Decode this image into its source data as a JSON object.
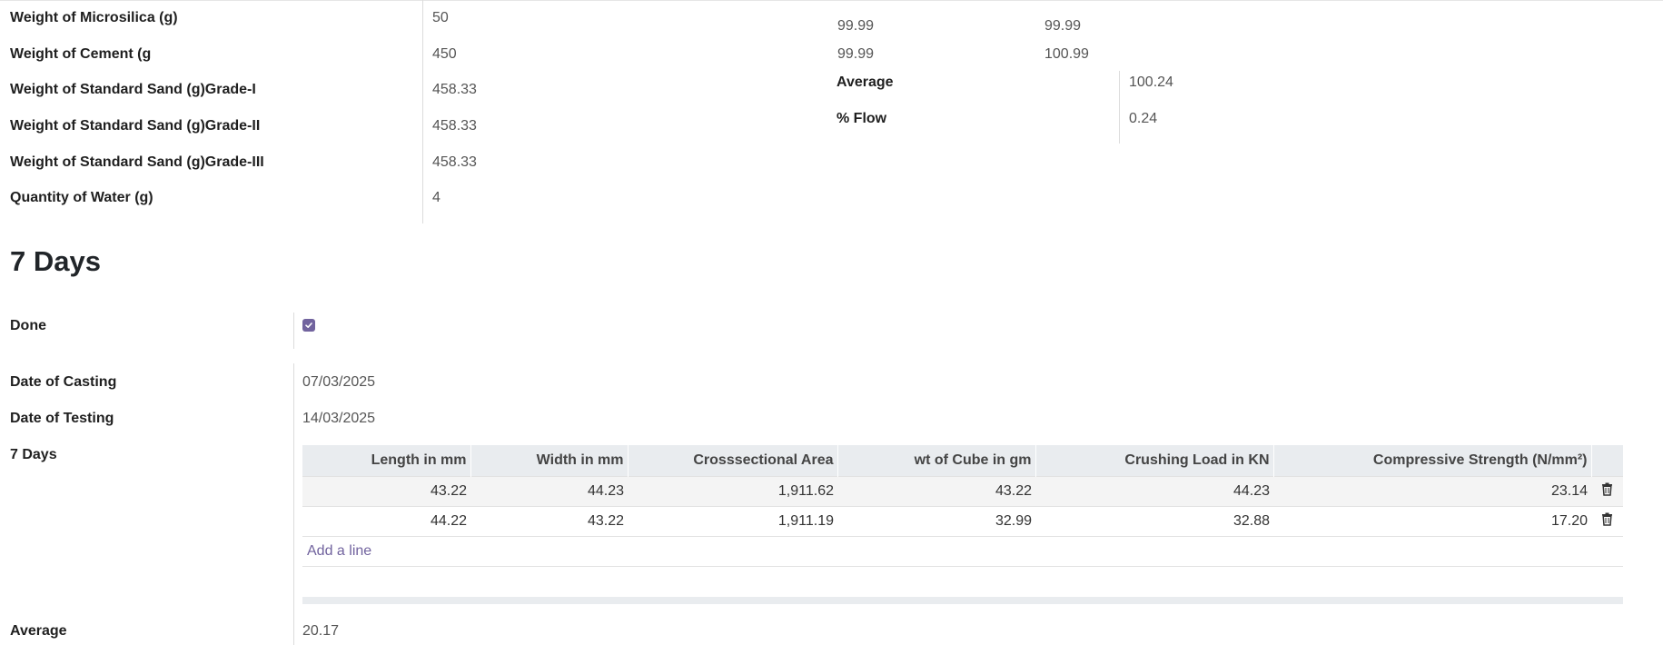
{
  "mix_fields": [
    {
      "label": "Weight of Microsilica (g)",
      "value": "50"
    },
    {
      "label": "Weight of Cement (g",
      "value": "450"
    },
    {
      "label": "Weight of Standard Sand (g)Grade-I",
      "value": "458.33"
    },
    {
      "label": "Weight of Standard Sand (g)Grade-II",
      "value": "458.33"
    },
    {
      "label": "Weight of Standard Sand (g)Grade-III",
      "value": "458.33"
    },
    {
      "label": "Quantity of Water (g)",
      "value": "4"
    }
  ],
  "flow": {
    "readings": [
      [
        "99.99",
        "99.99"
      ],
      [
        "99.99",
        "100.99"
      ]
    ],
    "average_label": "Average",
    "average_value": "100.24",
    "flow_label": "% Flow",
    "flow_value": "0.24"
  },
  "seven_days": {
    "title": "7 Days",
    "done_label": "Done",
    "done_checked": true,
    "casting_label": "Date of Casting",
    "casting_value": "07/03/2025",
    "testing_label": "Date of Testing",
    "testing_value": "14/03/2025",
    "table_label": "7 Days",
    "table": {
      "columns": [
        "Length in mm",
        "Width in mm",
        "Crosssectional Area",
        "wt of Cube in gm",
        "Crushing Load in KN",
        "Compressive Strength (N/mm²)"
      ],
      "rows": [
        [
          "43.22",
          "44.23",
          "1,911.62",
          "43.22",
          "44.23",
          "23.14"
        ],
        [
          "44.22",
          "43.22",
          "1,911.19",
          "32.99",
          "32.88",
          "17.20"
        ]
      ],
      "add_line": "Add a line",
      "delete_icon": "trash-icon"
    },
    "average_label": "Average",
    "average_value": "20.17"
  },
  "colors": {
    "accent": "#71639e",
    "header_bg": "#e9ecef",
    "odd_row_bg": "#f4f4f4"
  }
}
